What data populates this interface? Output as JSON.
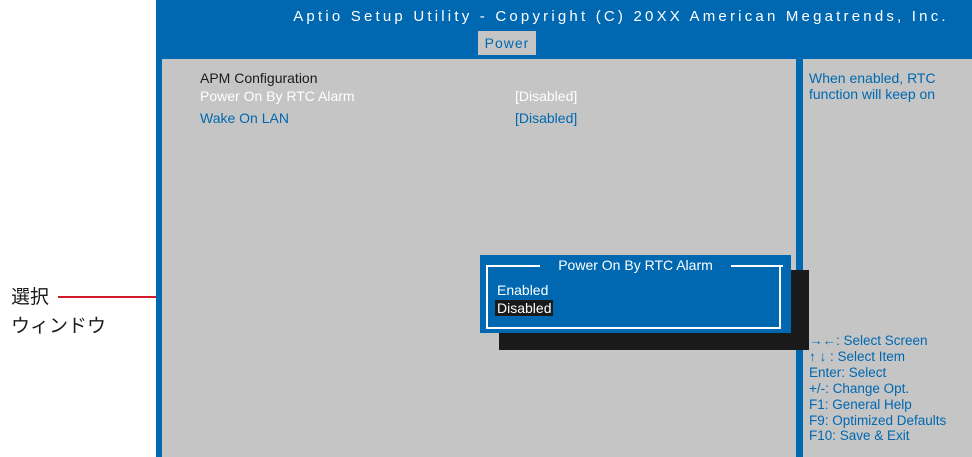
{
  "callout": {
    "line1": "選択",
    "line2": "ウィンドウ"
  },
  "header": {
    "title": "Aptio Setup Utility - Copyright (C) 20XX American Megatrends, Inc.",
    "tab": "Power"
  },
  "main": {
    "section_title": "APM Configuration",
    "items": [
      {
        "label": "Power On By RTC Alarm",
        "value": "[Disabled]"
      },
      {
        "label": "Wake On LAN",
        "value": "[Disabled]"
      }
    ]
  },
  "help": {
    "lines": [
      "When enabled, RTC",
      "function will keep on"
    ],
    "keys": [
      "→←: Select Screen",
      "↑ ↓ : Select Item",
      "Enter: Select",
      "+/-: Change Opt.",
      "F1: General Help",
      "F9: Optimized Defaults",
      "F10: Save & Exit"
    ]
  },
  "popup": {
    "title": "Power On By RTC Alarm",
    "options": [
      "Enabled",
      "Disabled"
    ]
  },
  "colors": {
    "bios_blue": "#0068b0",
    "panel_gray": "#c5c5c5",
    "callout_red": "#d01c2a"
  }
}
